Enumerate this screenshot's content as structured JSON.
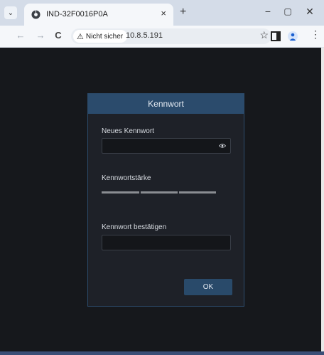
{
  "browser": {
    "tab_title": "IND-32F0016P0A",
    "tab_close": "×",
    "new_tab": "+",
    "minimize": "−",
    "maximize": "▢",
    "close": "✕",
    "back": "←",
    "forward": "→",
    "reload": "C",
    "security_label": "Nicht sicher",
    "warning_glyph": "⚠",
    "url": "10.8.5.191",
    "star_glyph": "☆",
    "menu_glyph": "⋮",
    "tab_menu_glyph": "⌄"
  },
  "dialog": {
    "title": "Kennwort",
    "new_password_label": "Neues Kennwort",
    "new_password_value": "",
    "strength_label": "Kennwortstärke",
    "strength_level": 0,
    "confirm_label": "Kennwort bestätigen",
    "confirm_value": "",
    "ok_label": "OK"
  },
  "colors": {
    "page_bg": "#16181c",
    "dialog_bg": "#1e2128",
    "accent": "#2b4b6c"
  },
  "icons": [
    "chrome-icon",
    "tab-close-icon",
    "back-icon",
    "forward-icon",
    "reload-icon",
    "warning-icon",
    "star-icon",
    "side-panel-icon",
    "profile-icon",
    "kebab-menu-icon",
    "eye-icon"
  ]
}
